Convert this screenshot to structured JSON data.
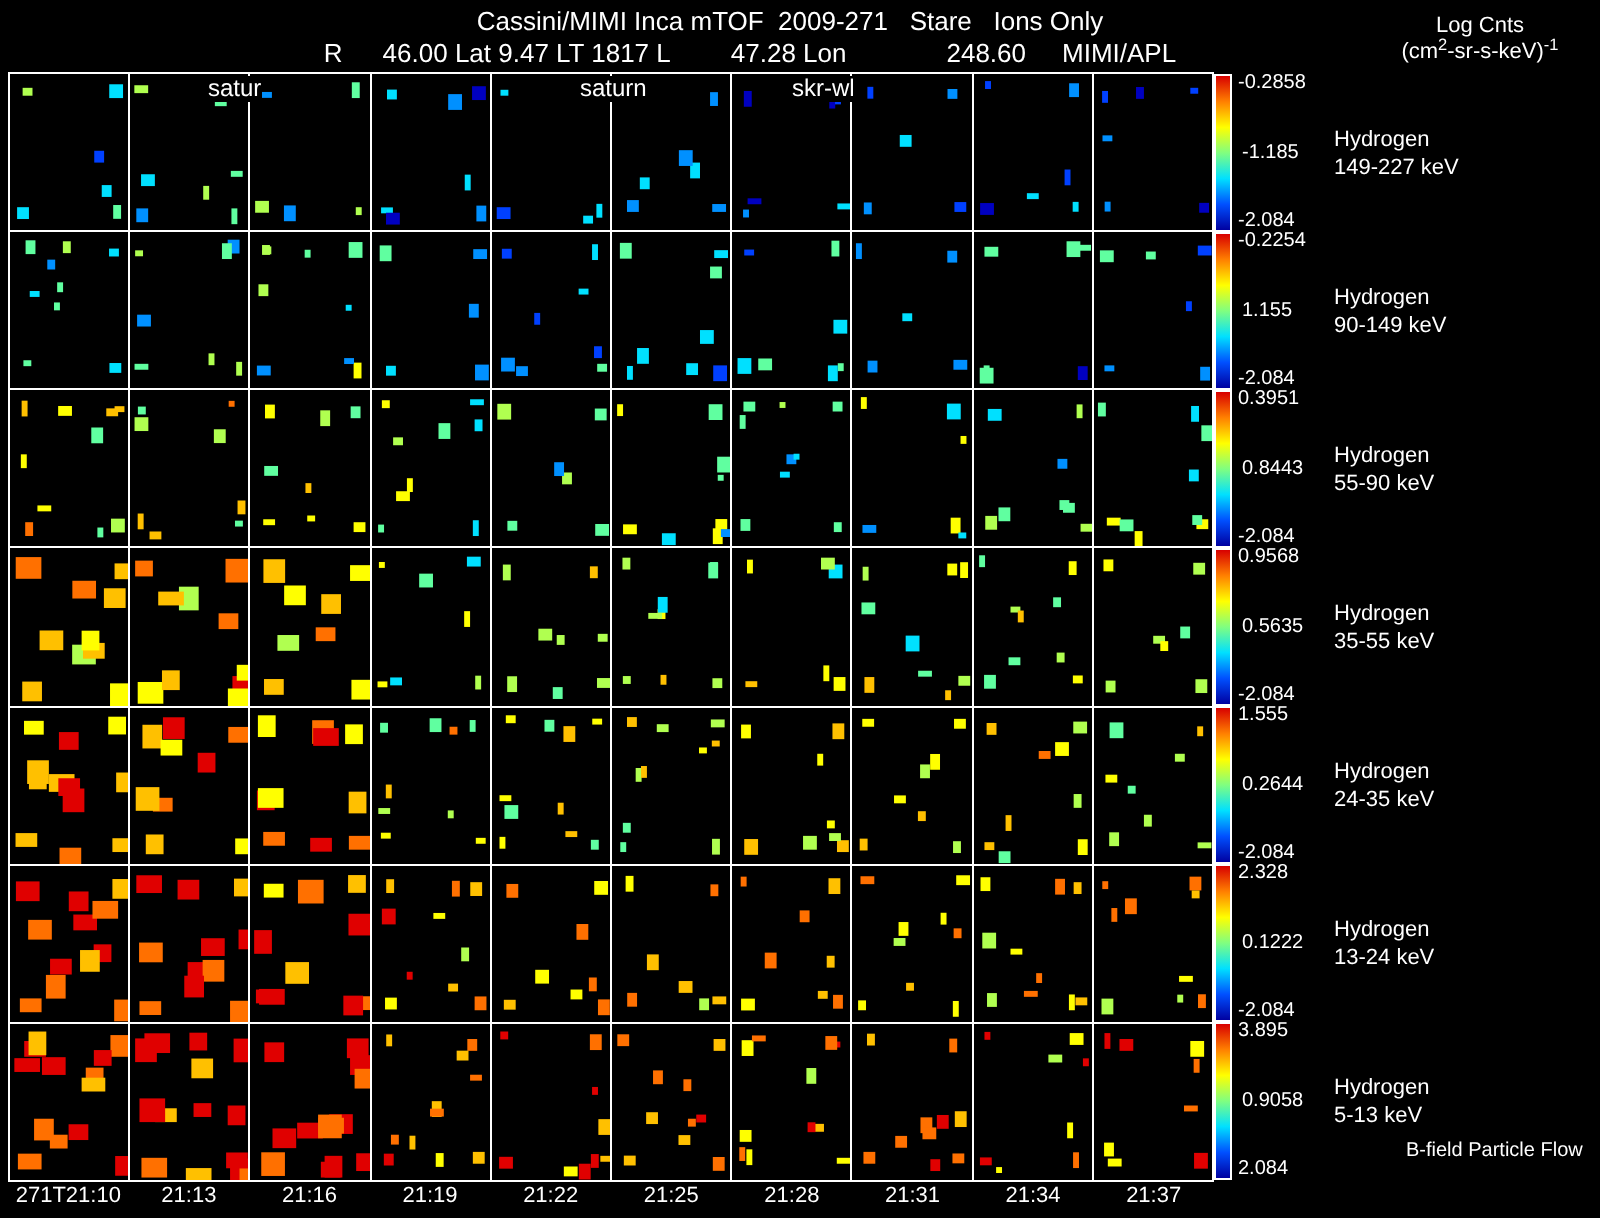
{
  "title": "Cassini/MIMI Inca mTOF  2009-271   Stare   Ions Only",
  "subtitle": [
    "R",
    "46.00 Lat 9.47 LT 1817 L",
    "47.28 Lon",
    "248.60",
    "MIMI/APL"
  ],
  "legend_title": [
    "Log Cnts",
    "(cm$^{2}$-sr-s-keV)$^{-1}$"
  ],
  "orbit_labels": [
    "satur",
    "saturn",
    "skr-wl"
  ],
  "panels": [
    {
      "species": "Hydrogen",
      "energy": "149-227 keV",
      "max": "-0.2858",
      "mid": "-1.185",
      "min": "-2.084"
    },
    {
      "species": "Hydrogen",
      "energy": "90-149 keV",
      "max": "-0.2254",
      "mid": "1.155",
      "min": "-2.084"
    },
    {
      "species": "Hydrogen",
      "energy": "55-90 keV",
      "max": "0.3951",
      "mid": "0.8443",
      "min": "-2.084"
    },
    {
      "species": "Hydrogen",
      "energy": "35-55 keV",
      "max": "0.9568",
      "mid": "0.5635",
      "min": "-2.084"
    },
    {
      "species": "Hydrogen",
      "energy": "24-35 keV",
      "max": "1.555",
      "mid": "0.2644",
      "min": "-2.084"
    },
    {
      "species": "Hydrogen",
      "energy": "13-24 keV",
      "max": "2.328",
      "mid": "0.1222",
      "min": "-2.084"
    },
    {
      "species": "Hydrogen",
      "energy": "5-13 keV",
      "max": "3.895",
      "mid": "0.9058",
      "min": "2.084"
    }
  ],
  "times": [
    "271T21:10",
    "21:13",
    "21:16",
    "21:19",
    "21:22",
    "21:25",
    "21:28",
    "21:31",
    "21:34",
    "21:37"
  ],
  "footnote": "B-field Particle Flow"
}
